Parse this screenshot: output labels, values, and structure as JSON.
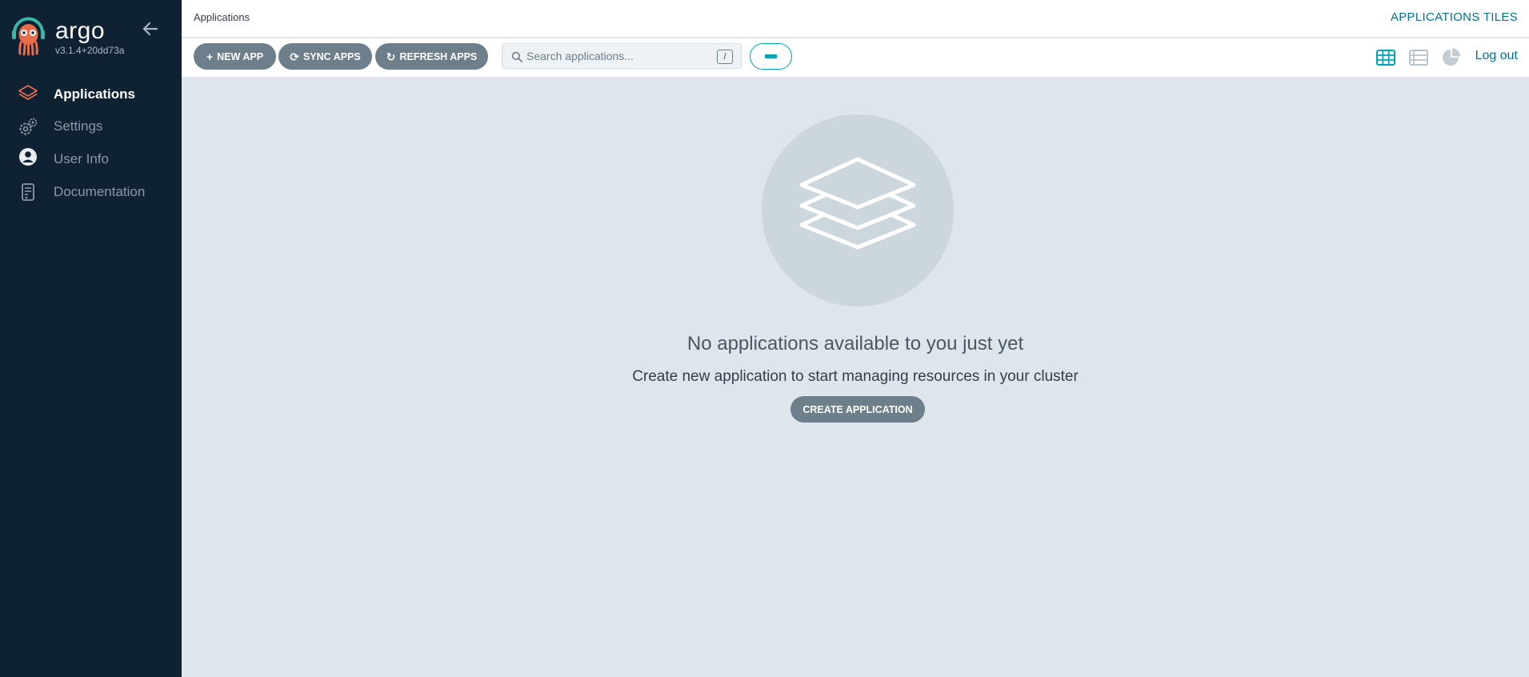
{
  "app": {
    "brand": "argo",
    "version": "v3.1.4+20dd73a"
  },
  "sidebar": {
    "items": [
      {
        "label": "Applications",
        "icon": "layers-icon",
        "active": true
      },
      {
        "label": "Settings",
        "icon": "gears-icon",
        "active": false
      },
      {
        "label": "User Info",
        "icon": "user-circle-icon",
        "active": false
      },
      {
        "label": "Documentation",
        "icon": "book-icon",
        "active": false
      }
    ]
  },
  "header": {
    "breadcrumb": "Applications",
    "title": "APPLICATIONS TILES"
  },
  "toolbar": {
    "new_app": "NEW APP",
    "sync_apps": "SYNC APPS",
    "refresh_apps": "REFRESH APPS",
    "search_placeholder": "Search applications...",
    "search_shortcut": "/",
    "logout": "Log out",
    "active_view": "tiles"
  },
  "empty_state": {
    "title": "No applications available to you just yet",
    "subtitle": "Create new application to start managing resources in your cluster",
    "button": "CREATE APPLICATION"
  },
  "colors": {
    "sidebar_bg": "#0f2233",
    "accent": "#00a2b3",
    "brand_orange": "#e96d4c",
    "button_gray": "#6d7f8b",
    "page_bg": "#dee6eb"
  }
}
